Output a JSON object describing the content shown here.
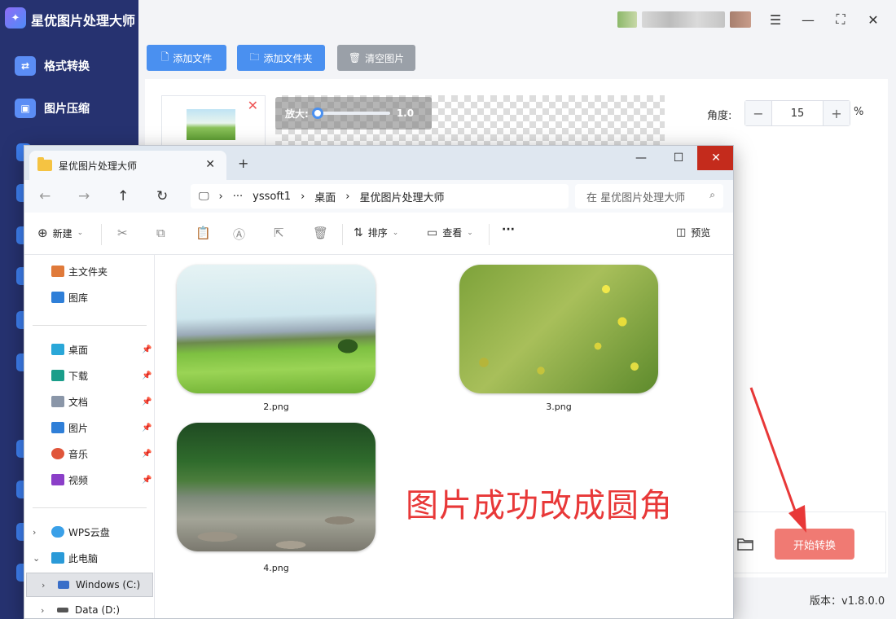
{
  "app": {
    "title": "星优图片处理大师",
    "logo_icon": "image-icon",
    "sidebar": {
      "items": [
        {
          "label": "格式转换",
          "icon": "convert-icon"
        },
        {
          "label": "图片压缩",
          "icon": "compress-icon"
        }
      ]
    },
    "toolbar": {
      "add_file": "添加文件",
      "add_folder": "添加文件夹",
      "clear_images": "清空图片"
    },
    "preview": {
      "zoom_label": "放大:",
      "zoom_value": "1.0",
      "zoom_fraction": 0.0
    },
    "settings": {
      "angle_label": "角度:",
      "angle_minus": "−",
      "angle_value": "15",
      "angle_plus": "+",
      "angle_unit": "%"
    },
    "start_button": "开始转换",
    "version": "版本：v1.8.0.0",
    "colors": {
      "sidebar": "#263270",
      "primary": "#4a90f0",
      "start": "#f07a73"
    }
  },
  "explorer": {
    "tab_title": "星优图片处理大师",
    "breadcrumb": [
      "···",
      "yssoft1",
      "桌面",
      "星优图片处理大师"
    ],
    "search_placeholder": "在 星优图片处理大师",
    "commands": {
      "new": "新建",
      "sort": "排序",
      "view": "查看",
      "more": "···",
      "preview": "预览"
    },
    "nav_top": [
      {
        "label": "主文件夹",
        "icon": "home-icon"
      },
      {
        "label": "图库",
        "icon": "gallery-icon"
      }
    ],
    "nav_quick": [
      {
        "label": "桌面",
        "icon": "desktop-icon"
      },
      {
        "label": "下载",
        "icon": "download-icon"
      },
      {
        "label": "文档",
        "icon": "document-icon"
      },
      {
        "label": "图片",
        "icon": "pictures-icon"
      },
      {
        "label": "音乐",
        "icon": "music-icon"
      },
      {
        "label": "视频",
        "icon": "video-icon"
      }
    ],
    "nav_tree": [
      {
        "label": "WPS云盘",
        "icon": "cloud-icon"
      },
      {
        "label": "此电脑",
        "icon": "computer-icon"
      },
      {
        "label": "Windows (C:)",
        "icon": "drive-icon"
      },
      {
        "label": "Data (D:)",
        "icon": "drive-icon"
      }
    ],
    "files": [
      {
        "name": "2.png"
      },
      {
        "name": "3.png"
      },
      {
        "name": "4.png"
      }
    ]
  },
  "annotation": "图片成功改成圆角"
}
